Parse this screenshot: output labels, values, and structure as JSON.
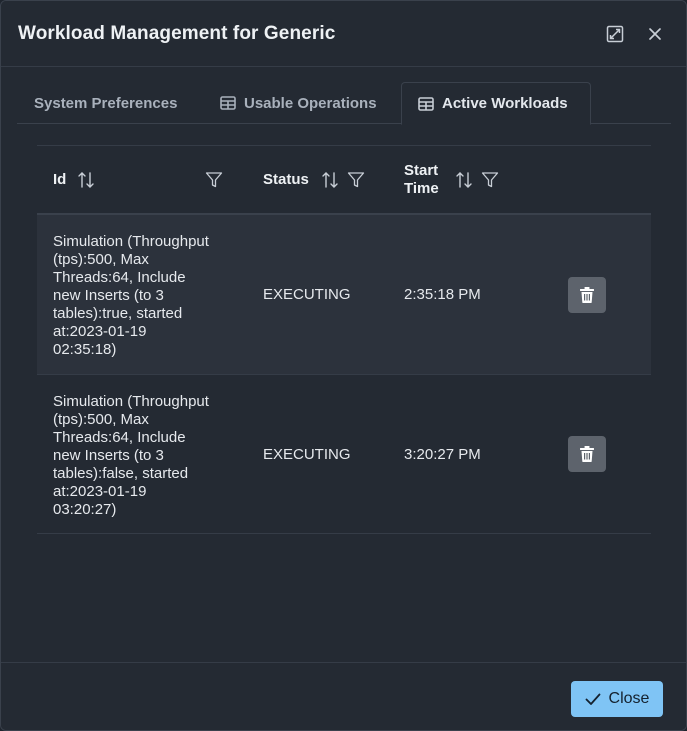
{
  "dialog": {
    "title": "Workload Management for Generic",
    "maximize_icon": "maximize-icon",
    "close_icon": "close-icon"
  },
  "tabs": [
    {
      "label": "System Preferences",
      "icon": null,
      "active": false
    },
    {
      "label": "Usable Operations",
      "icon": "table-icon",
      "active": false
    },
    {
      "label": "Active Workloads",
      "icon": "table-icon",
      "active": true
    }
  ],
  "table": {
    "columns": [
      {
        "label": "Id",
        "sortable": true,
        "filterable": true
      },
      {
        "label": "Status",
        "sortable": true,
        "filterable": true
      },
      {
        "label_line1": "Start",
        "label_line2": "Time",
        "sortable": true,
        "filterable": true
      }
    ],
    "rows": [
      {
        "id_lines": [
          "Simulation (Throughput",
          "(tps):500, Max",
          "Threads:64, Include",
          "new Inserts (to 3",
          "tables):true, started",
          "at:2023-01-19",
          "02:35:18)"
        ],
        "status": "EXECUTING",
        "start_time": "2:35:18 PM"
      },
      {
        "id_lines": [
          "Simulation (Throughput",
          "(tps):500, Max",
          "Threads:64, Include",
          "new Inserts (to 3",
          "tables):false, started",
          "at:2023-01-19",
          "03:20:27)"
        ],
        "status": "EXECUTING",
        "start_time": "3:20:27 PM"
      }
    ]
  },
  "footer": {
    "close_label": "Close",
    "close_icon": "check-icon"
  },
  "colors": {
    "background": "#242a33",
    "accent_button": "#7fc4f5",
    "row_highlight": "#2c323c",
    "delete_button": "#5d636c"
  }
}
